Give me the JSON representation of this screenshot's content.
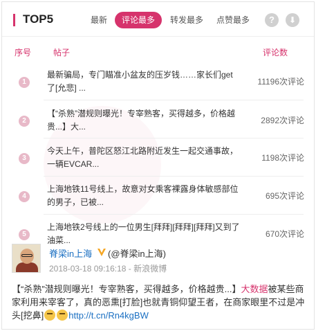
{
  "header": {
    "title": "TOP5",
    "tabs": [
      {
        "label": "最新"
      },
      {
        "label": "评论最多"
      },
      {
        "label": "转发最多"
      },
      {
        "label": "点赞最多"
      }
    ],
    "help_glyph": "?",
    "download_glyph": "⬇"
  },
  "columns": {
    "rank": "序号",
    "post": "帖子",
    "comments": "评论数"
  },
  "rows": [
    {
      "rank": "1",
      "text": "最新骗局，专门瞄准小盆友的压岁钱……家长们get了[允悲] ...",
      "count": "11196次评论"
    },
    {
      "rank": "2",
      "text": "【“杀熟”潜规则曝光！专宰熟客，买得越多，价格越贵...】大...",
      "count": "2892次评论"
    },
    {
      "rank": "3",
      "text": "今天上午，普陀区怒江北路附近发生一起交通事故，一辆EVCAR...",
      "count": "1198次评论"
    },
    {
      "rank": "4",
      "text": "上海地铁11号线上，故意对女乘客裸露身体敏感部位的男子，已被...",
      "count": "695次评论"
    },
    {
      "rank": "5",
      "text": "上海地铁2号线上的一位男生[拜拜][拜拜][拜拜]又到了油菜...",
      "count": "670次评论"
    }
  ],
  "post": {
    "user": "脊梁in上海",
    "handle": "(@脊梁in上海)",
    "datetime": "2018-03-18 09:16:18",
    "separator": " - ",
    "source": "新浪微博",
    "text_part1": "【“杀熟”潜规则曝光！专宰熟客，买得越多，价格越贵...】",
    "text_highlight": "大数据",
    "text_part2": "被某些商家利用来宰客了，真的恶熏[打脸]也就青铜仰望王者，在商家眼里不过是冲头[挖鼻]",
    "link": "http://t.cn/Rn4kgBW"
  },
  "colors": {
    "accent": "#d6336c",
    "link": "#1a6fc2",
    "rank_badge": "#e8b9c8"
  }
}
